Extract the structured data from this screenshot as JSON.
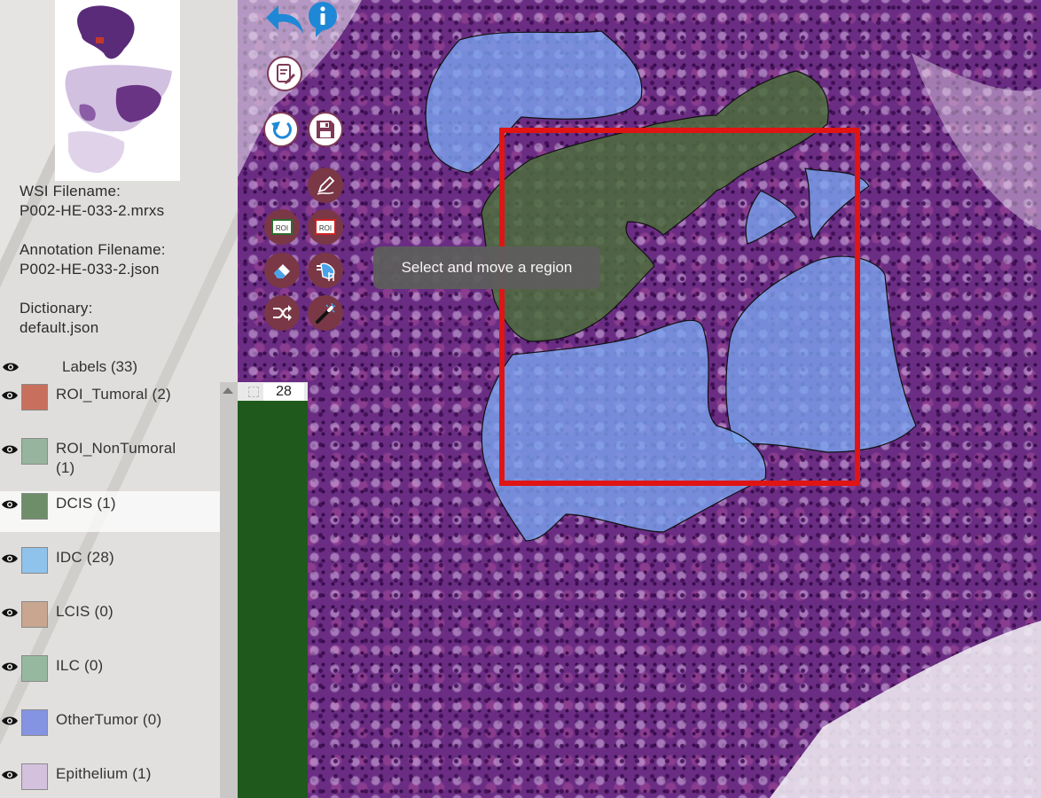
{
  "slide_info": {
    "wsi_label": "WSI Filename:",
    "wsi_value": "P002-HE-033-2.mrxs",
    "annotation_label": "Annotation Filename:",
    "annotation_value": "P002-HE-033-2.json",
    "dictionary_label": "Dictionary:",
    "dictionary_value": "default.json"
  },
  "labels": {
    "title": "Labels (33)",
    "items": [
      {
        "name": "ROI_Tumoral (2)",
        "color": "#c8705d"
      },
      {
        "name": "ROI_NonTumoral (1)",
        "color": "#97b49e"
      },
      {
        "name": "DCIS (1)",
        "color": "#6e8e6a"
      },
      {
        "name": "IDC (28)",
        "color": "#8fc3ec"
      },
      {
        "name": "LCIS (0)",
        "color": "#c9a690"
      },
      {
        "name": "ILC (0)",
        "color": "#96b89f"
      },
      {
        "name": "OtherTumor (0)",
        "color": "#8593e3"
      },
      {
        "name": "Epithelium (1)",
        "color": "#d4c1de"
      }
    ]
  },
  "region_counter": "28",
  "tooltip": "Select and move a region",
  "colors": {
    "roi_box": "#e01414",
    "idc_fill": "#7aa6f2",
    "dcis_fill": "#4b6d3c",
    "tool_dark": "#7a3746",
    "tool_light_border": "#7e3a56",
    "accent_blue": "#1e88d6"
  },
  "toolbar_icons": [
    "back-arrow-icon",
    "info-icon",
    "notes-icon",
    "undo-icon",
    "save-icon",
    "pencil-icon",
    "roi-icon",
    "roi-red-icon",
    "eraser-icon",
    "select-hand-icon",
    "shuffle-icon",
    "magic-wand-icon"
  ]
}
